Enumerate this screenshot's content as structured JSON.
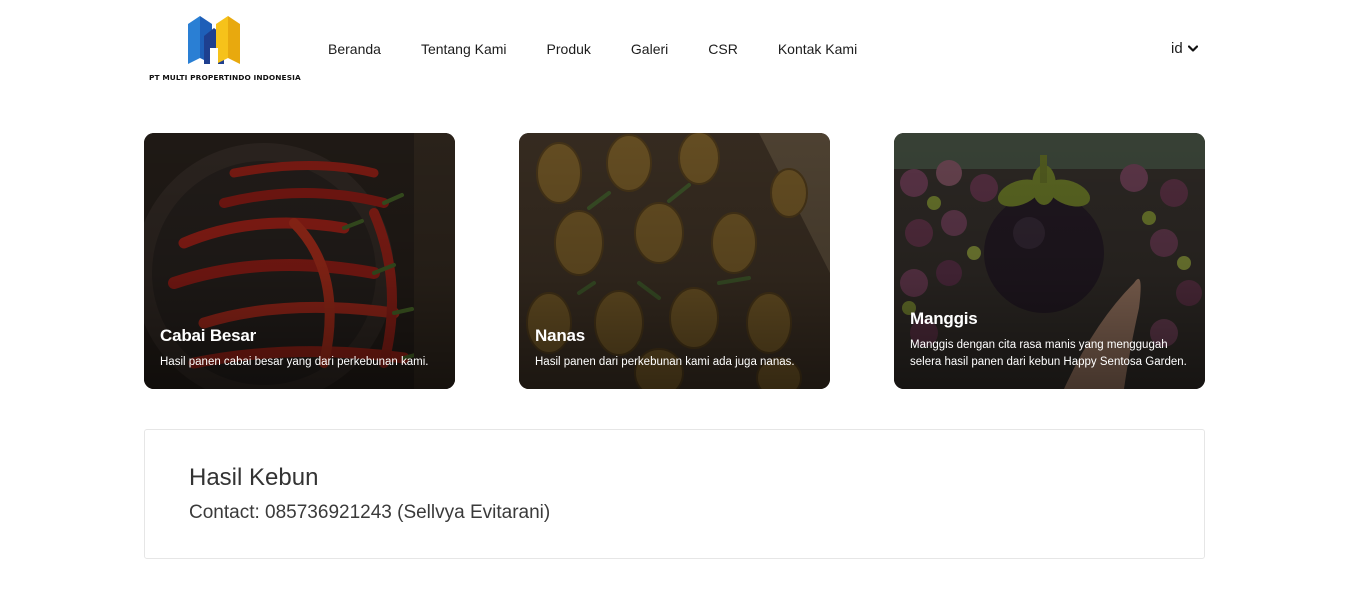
{
  "brand": {
    "name": "PT MULTI PROPERTINDO INDONESIA",
    "colors": {
      "blue": "#2a7fd4",
      "yellow": "#f6c21a",
      "navy": "#1e3f8f"
    }
  },
  "nav": {
    "items": [
      {
        "label": "Beranda"
      },
      {
        "label": "Tentang Kami"
      },
      {
        "label": "Produk"
      },
      {
        "label": "Galeri"
      },
      {
        "label": "CSR"
      },
      {
        "label": "Kontak Kami"
      }
    ]
  },
  "language": {
    "selected": "id",
    "icon": "chevron-down-icon"
  },
  "cards": [
    {
      "title": "Cabai Besar",
      "description": "Hasil panen cabai besar yang dari perkebunan kami.",
      "image": "red-chili-photo"
    },
    {
      "title": "Nanas",
      "description": "Hasil panen dari perkebunan kami ada juga nanas.",
      "image": "pineapple-photo"
    },
    {
      "title": "Manggis",
      "description": "Manggis dengan cita rasa manis yang menggugah selera hasil panen dari kebun Happy Sentosa Garden.",
      "image": "mangosteen-photo"
    }
  ],
  "info": {
    "title": "Hasil Kebun",
    "contact": "Contact: 085736921243 (Sellvya Evitarani)"
  }
}
